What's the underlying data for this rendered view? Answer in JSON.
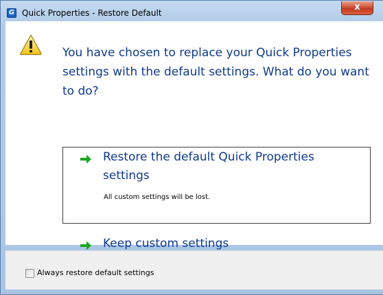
{
  "window": {
    "title": "Quick Properties - Restore Default",
    "app_icon_letter": "G",
    "close_glyph": "x"
  },
  "dialog": {
    "icon": "warning-icon",
    "instruction": "You have chosen to replace your Quick Properties settings with the default settings. What do you want to do?",
    "options": [
      {
        "label": "Restore the default Quick Properties settings",
        "note": "All custom settings will be lost.",
        "icon": "green-arrow-icon",
        "selected": true
      },
      {
        "label": "Keep custom settings",
        "icon": "green-arrow-icon",
        "selected": false
      }
    ]
  },
  "footer": {
    "checkbox_label": "Always restore default settings",
    "checked": false
  },
  "colors": {
    "instruction_text": "#0f3a8c",
    "arrow": "#18a820",
    "frame": "#b3cde9"
  }
}
